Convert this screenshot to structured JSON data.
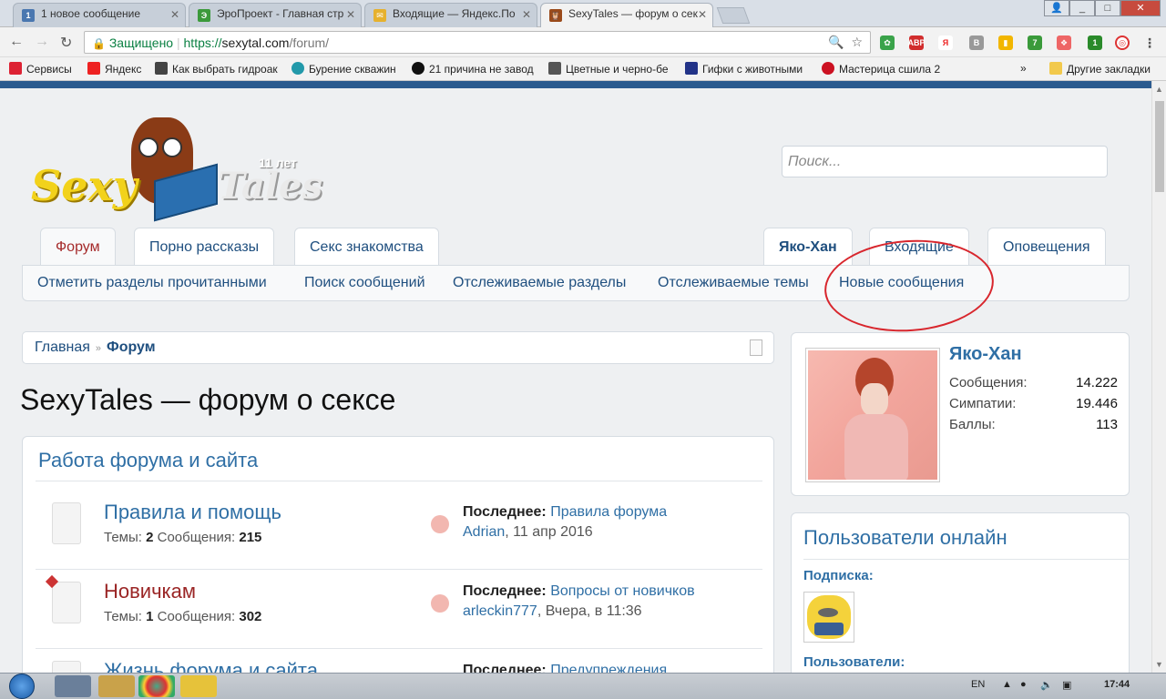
{
  "browser": {
    "tabs": [
      {
        "title": "1 новое сообщение",
        "icon_text": "1",
        "color": "#4a77b0"
      },
      {
        "title": "ЭроПроект - Главная стр",
        "icon_text": "Э",
        "color": "#3b9a3b"
      },
      {
        "title": "Входящие — Яндекс.По",
        "icon_text": "✉",
        "color": "#e6b12e"
      },
      {
        "title": "SexyTales — форум о сек",
        "icon_text": "🦉",
        "color": "#9a4a1a"
      }
    ],
    "address": {
      "secure_label": "Защищено",
      "url_scheme": "https://",
      "url_host": "sexytal.com",
      "url_path": "/forum/"
    },
    "bookmarks": [
      {
        "label": "Сервисы",
        "color": "#d23"
      },
      {
        "label": "Яндекс",
        "color": "#e22"
      },
      {
        "label": "Как выбрать гидроак",
        "color": "#444"
      },
      {
        "label": "Бурение скважин",
        "color": "#29a"
      },
      {
        "label": "21 причина не завод",
        "color": "#111"
      },
      {
        "label": "Цветные и черно-бе",
        "color": "#555"
      },
      {
        "label": "Гифки с животными",
        "color": "#238"
      },
      {
        "label": "Мастерица сшила 2",
        "color": "#c12"
      }
    ],
    "other_bookmarks": "Другие закладки",
    "more_bookmarks": "»",
    "extension_badges": {
      "ext7": "7",
      "ext1": "1"
    }
  },
  "logo": {
    "years": "11 лет",
    "word1": "Sexy",
    "word2": "Tales"
  },
  "search": {
    "placeholder": "Поиск..."
  },
  "nav": {
    "tabs": [
      "Форум",
      "Порно рассказы",
      "Секс знакомства"
    ],
    "user_tabs": [
      "Яко-Хан",
      "Входящие",
      "Оповещения"
    ],
    "subnav": [
      "Отметить разделы прочитанными",
      "Поиск сообщений",
      "Отслеживаемые разделы",
      "Отслеживаемые темы",
      "Новые сообщения"
    ]
  },
  "breadcrumb": {
    "home": "Главная",
    "sep": "»",
    "current": "Форум"
  },
  "page_title": "SexyTales — форум о сексе",
  "category": {
    "title": "Работа форума и сайта",
    "nodes": [
      {
        "title": "Правила и помощь",
        "threads_label": "Темы:",
        "threads": "2",
        "posts_label": "Сообщения:",
        "posts": "215",
        "last_label": "Последнее:",
        "last_title": "Правила форума",
        "last_user": "Adrian",
        "last_date": ", 11 апр 2016",
        "unread": false
      },
      {
        "title": "Новичкам",
        "threads_label": "Темы:",
        "threads": "1",
        "posts_label": "Сообщения:",
        "posts": "302",
        "last_label": "Последнее:",
        "last_title": "Вопросы от новичков",
        "last_user": "arleckin777",
        "last_date": ", Вчера, в 11:36",
        "unread": true
      },
      {
        "title": "Жизнь форума и сайта",
        "threads_label": "",
        "threads": "",
        "posts_label": "",
        "posts": "",
        "last_label": "Последнее:",
        "last_title": "Предупреждения",
        "last_user": "",
        "last_date": "",
        "unread": false
      }
    ]
  },
  "sidebar": {
    "user": {
      "name": "Яко-Хан",
      "stats": [
        {
          "label": "Сообщения:",
          "value": "14.222"
        },
        {
          "label": "Симпатии:",
          "value": "19.446"
        },
        {
          "label": "Баллы:",
          "value": "113"
        }
      ]
    },
    "online": {
      "title": "Пользователи онлайн",
      "subs_label": "Подписка:",
      "users_label": "Пользователи:"
    }
  },
  "taskbar": {
    "lang": "EN",
    "time": "17:44"
  },
  "colors": {
    "accent": "#2f6fa5",
    "annotation": "#d8262d",
    "topbar": "#2b5b8f"
  }
}
